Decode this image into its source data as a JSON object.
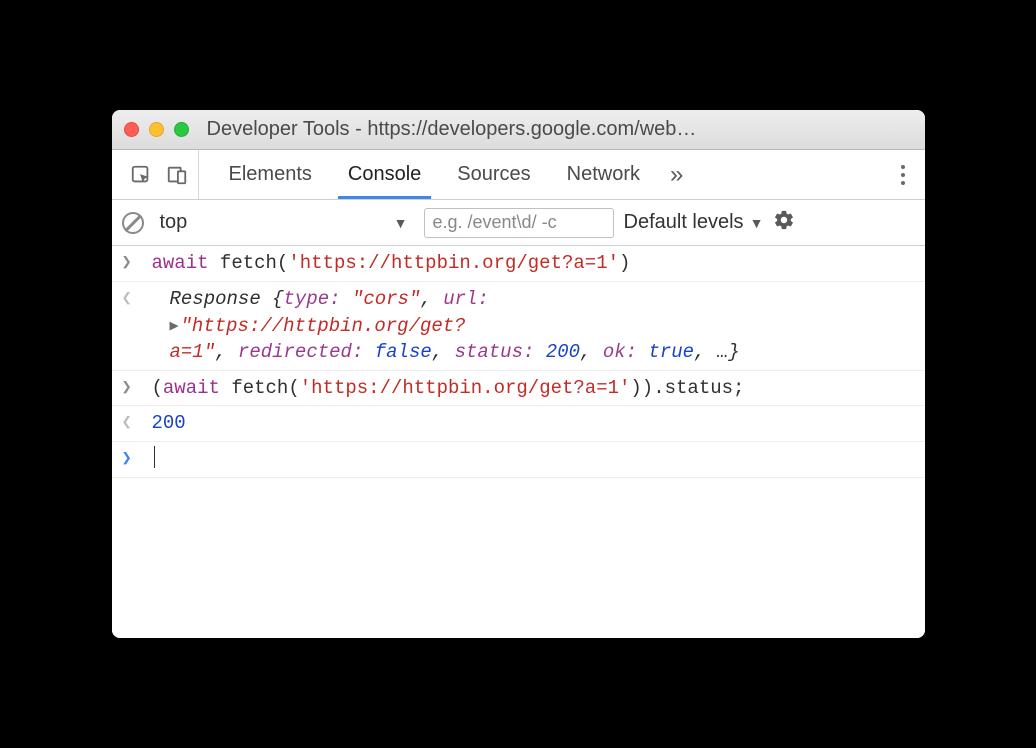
{
  "window": {
    "title": "Developer Tools - https://developers.google.com/web…"
  },
  "tabs": {
    "elements": "Elements",
    "console": "Console",
    "sources": "Sources",
    "network": "Network",
    "more": "»"
  },
  "filter": {
    "context": "top",
    "placeholder": "e.g. /event\\d/ -c",
    "levels": "Default levels"
  },
  "console": {
    "row1": {
      "kw": "await",
      "fn": " fetch(",
      "str": "'https://httpbin.org/get?a=1'",
      "tail": ")"
    },
    "row2": {
      "head": "Response ",
      "brace_open": "{",
      "k_type": "type: ",
      "v_type": "\"cors\"",
      "c1": ", ",
      "k_url": "url: ",
      "v_url_a": "\"https://httpbin.org/get?",
      "v_url_b": "a=1\"",
      "c2": ", ",
      "k_red": "redirected: ",
      "v_red": "false",
      "c3": ", ",
      "k_status": "status: ",
      "v_status": "200",
      "c4": ", ",
      "k_ok": "ok: ",
      "v_ok": "true",
      "c5": ", ",
      "ellip": "…",
      "brace_close": "}"
    },
    "row3": {
      "open": "(",
      "kw": "await",
      "fn": " fetch(",
      "str": "'https://httpbin.org/get?a=1'",
      "close": ")).status;"
    },
    "row4": {
      "value": "200"
    }
  }
}
